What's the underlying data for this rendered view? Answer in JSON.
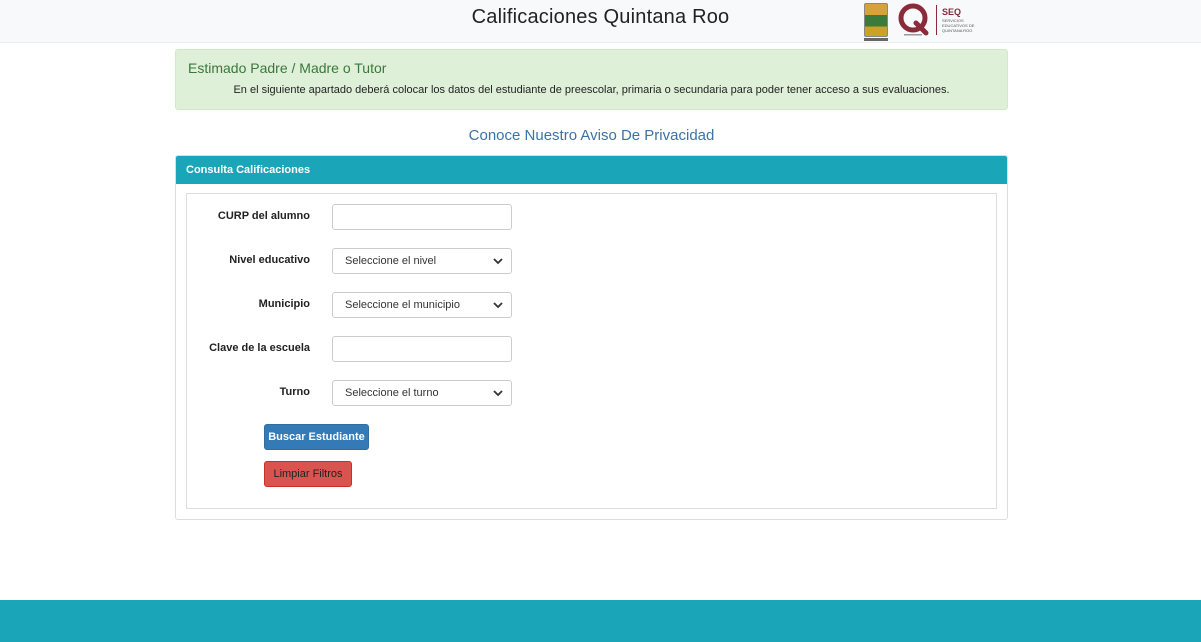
{
  "header": {
    "title": "Calificaciones Quintana Roo",
    "logos": {
      "seq_abbr": "SEQ",
      "seq_name": "SERVICIOS EDUCATIVOS DE QUINTANA ROO"
    }
  },
  "alert": {
    "heading": "Estimado Padre / Madre o Tutor",
    "text": "En el siguiente apartado deberá colocar los datos del estudiante de preescolar, primaria o secundaria para poder tener acceso a sus evaluaciones."
  },
  "privacy_link": "Conoce Nuestro Aviso De Privacidad",
  "panel": {
    "title": "Consulta Calificaciones",
    "fields": {
      "curp": {
        "label": "CURP del alumno",
        "value": ""
      },
      "nivel": {
        "label": "Nivel educativo",
        "selected": "Seleccione el nivel"
      },
      "municipio": {
        "label": "Municipio",
        "selected": "Seleccione el municipio"
      },
      "clave": {
        "label": "Clave de la escuela",
        "value": ""
      },
      "turno": {
        "label": "Turno",
        "selected": "Seleccione el turno"
      }
    },
    "buttons": {
      "search": "Buscar Estudiante",
      "clear": "Limpiar Filtros"
    }
  },
  "colors": {
    "accent_teal": "#1ba5b8",
    "primary_blue": "#337ab7",
    "danger_red": "#d9534f",
    "alert_green_bg": "#dff0d8",
    "link_blue": "#3a73a8",
    "seq_maroon": "#8b2a3b"
  }
}
